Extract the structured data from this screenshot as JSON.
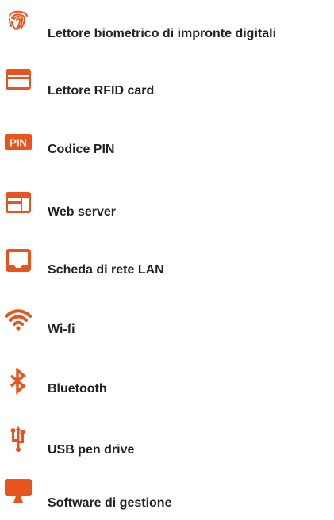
{
  "colors": {
    "icon": "#e8541c",
    "text": "#222222"
  },
  "features": [
    {
      "label": "Lettore biometrico di impronte digitali",
      "icon": "fingerprint-icon"
    },
    {
      "label": "Lettore RFID card",
      "icon": "credit-card-icon"
    },
    {
      "label": "Codice PIN",
      "icon": "pin-icon",
      "icon_text": "PIN"
    },
    {
      "label": "Web server",
      "icon": "browser-window-icon"
    },
    {
      "label": "Scheda di rete LAN",
      "icon": "inbox-tray-icon"
    },
    {
      "label": "Wi-fi",
      "icon": "wifi-icon"
    },
    {
      "label": "Bluetooth",
      "icon": "bluetooth-icon"
    },
    {
      "label": "USB pen drive",
      "icon": "usb-icon"
    },
    {
      "label": "Software di gestione",
      "icon": "monitor-icon"
    }
  ]
}
